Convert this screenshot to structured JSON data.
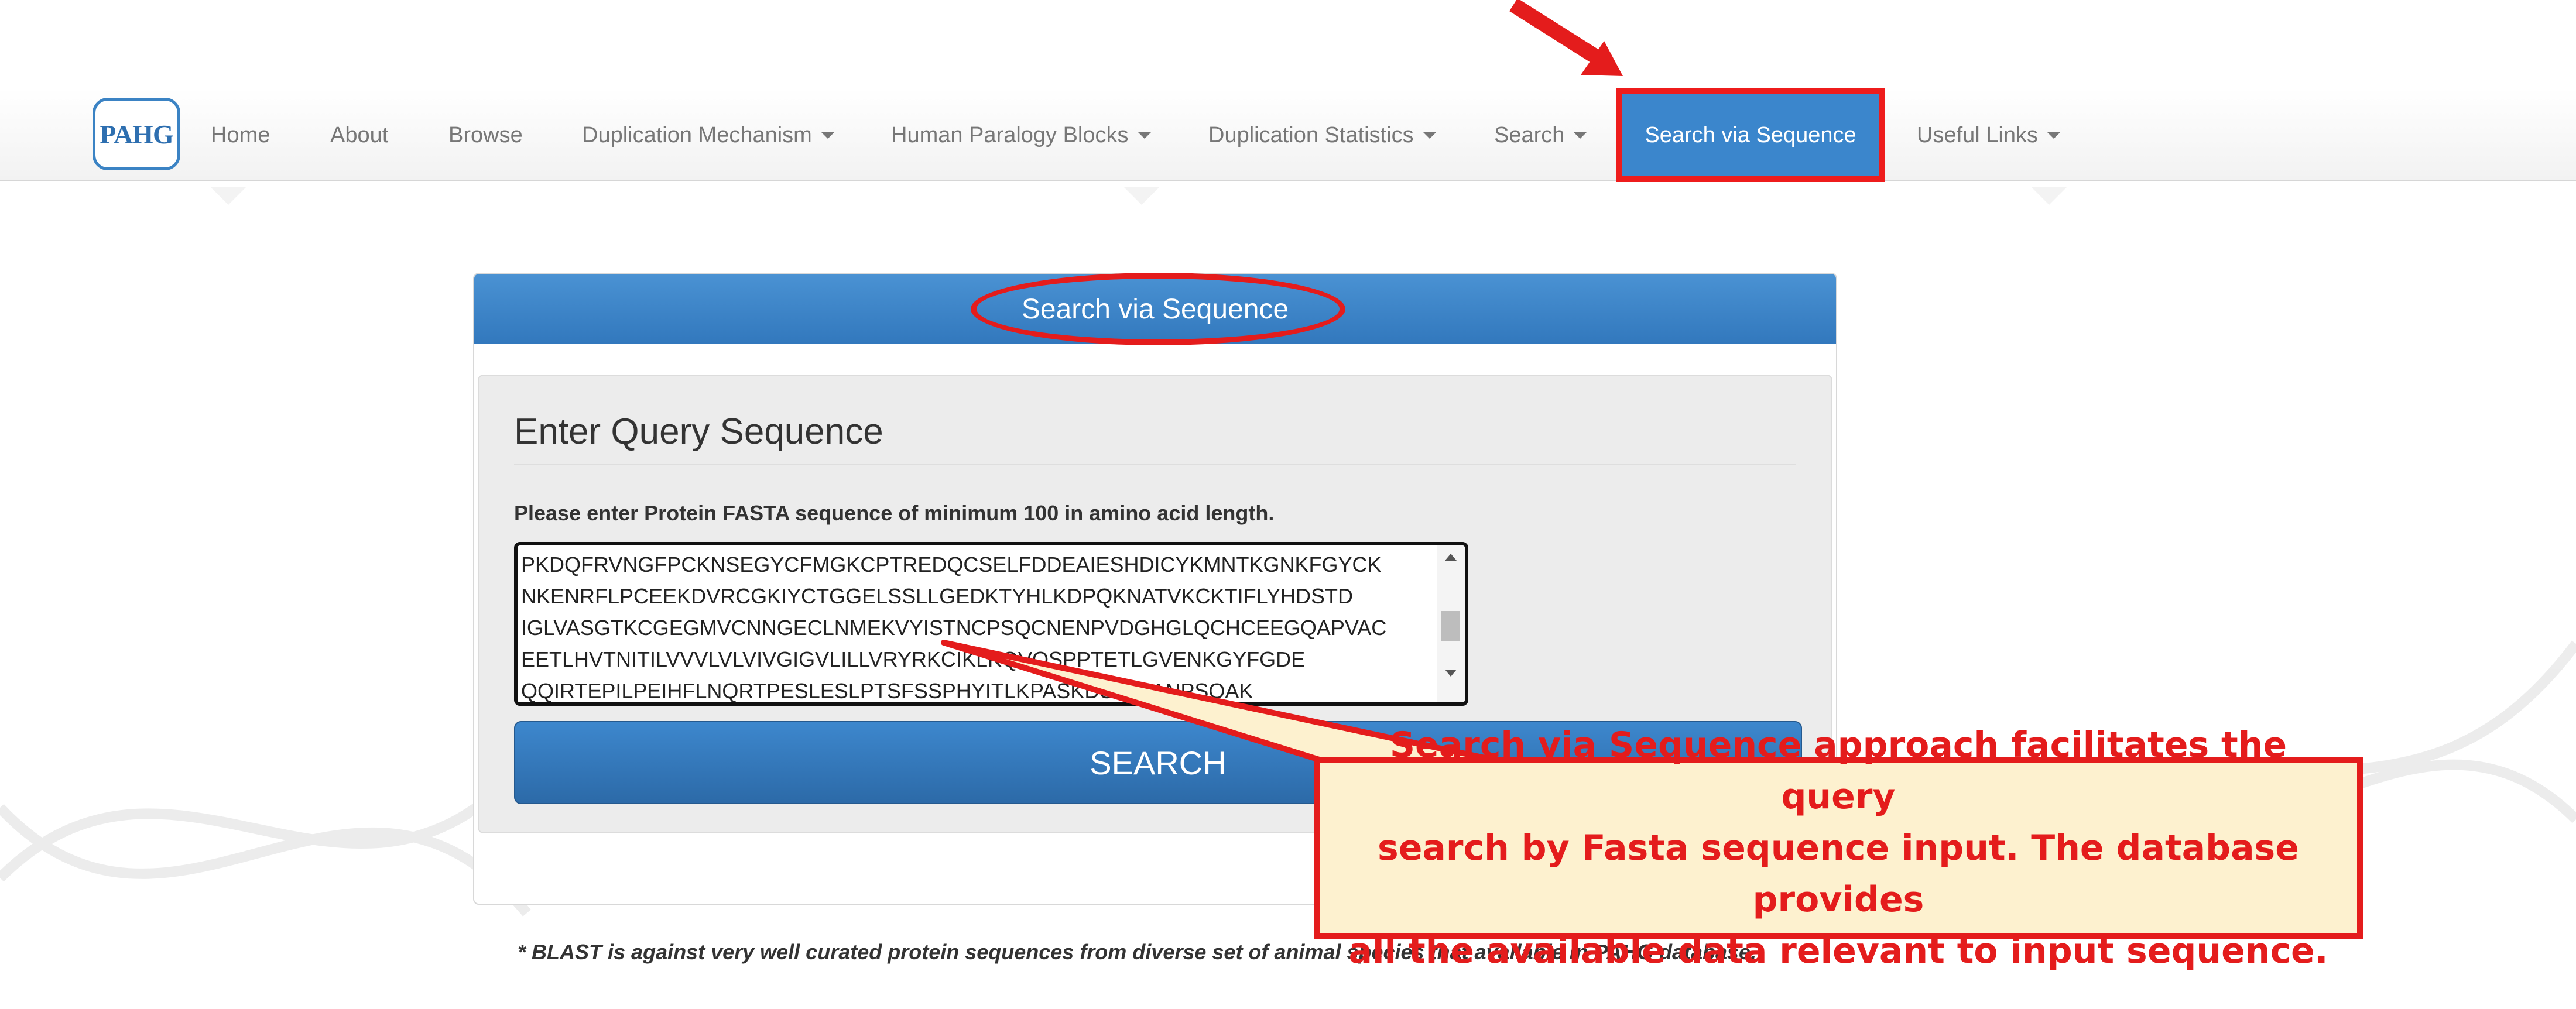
{
  "navbar": {
    "logo_text": "PAHG",
    "items": [
      {
        "label": "Home"
      },
      {
        "label": "About"
      },
      {
        "label": "Browse"
      },
      {
        "label": "Duplication Mechanism",
        "dropdown": true
      },
      {
        "label": "Human Paralogy Blocks",
        "dropdown": true
      },
      {
        "label": "Duplication Statistics",
        "dropdown": true
      },
      {
        "label": "Search",
        "dropdown": true
      },
      {
        "label": "Search via Sequence",
        "active": true
      },
      {
        "label": "Useful Links",
        "dropdown": true
      }
    ]
  },
  "panel": {
    "heading": "Search via Sequence",
    "well_title": "Enter Query Sequence",
    "help_text": "Please enter Protein FASTA sequence of minimum 100 in amino acid length.",
    "sequence_lines": [
      "PKDQFRVNGFPCKNSEGYCFMGKCPTREDQCSELFDDEAIESHDICYKMNTKGNKFGYCK",
      "NKENRFLPCEEKDVRCGKIYCTGGELSSLLGEDKTYHLKDPQKNATVKCKTIFLYHDSTD",
      "IGLVASGTKCGEGMVCNNGECLNMEKVYISTNCPSQCNENPVDGHGLQCHCEEGQAPVAC",
      "EETLHVTNITILVVVLVLVIVGIGVLILLVRYRKCIKLKQVQSPPTETLGVENKGYFGDE",
      "QQIRTEPILPEIHFLNQRTPESLESLPTSFSSPHYITLKPASKDSRGIANPSQAK"
    ],
    "search_button": "SEARCH"
  },
  "footnote": "* BLAST is against very well curated protein sequences from diverse set of animal species that available in PAHG database.",
  "callout": {
    "lines": [
      "Search via Sequence approach facilitates the query",
      "search by Fasta sequence input. The database provides",
      "all the available data relevant to input sequence."
    ]
  },
  "colors": {
    "accent": "#3b86cc",
    "annotation_red": "#e41c1c",
    "callout_bg": "#fdf1cf"
  }
}
